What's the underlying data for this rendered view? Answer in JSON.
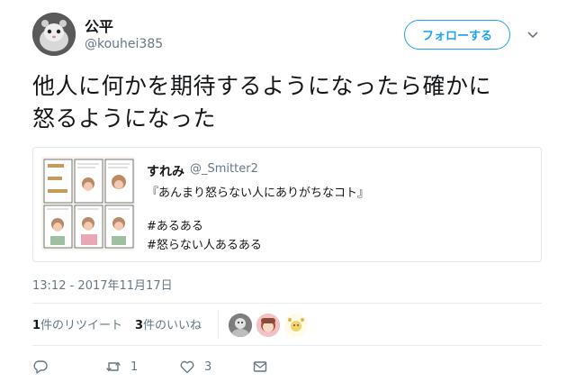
{
  "author": {
    "name": "公平",
    "handle": "@kouhei385",
    "follow_label": "フォローする"
  },
  "tweet": {
    "text_line1": "他人に何かを期待するようになったら確かに",
    "text_line2": "怒るようになった"
  },
  "quote": {
    "name": "すれみ",
    "handle": "@_Smitter2",
    "line1": "『あんまり怒らない人にありがちなコト』",
    "line2": "#あるある",
    "line3": "#怒らない人あるある"
  },
  "timestamp": "13:12 - 2017年11月17日",
  "stats": {
    "retweet_count": "1",
    "retweet_label": "件のリツイート",
    "like_count": "3",
    "like_label": "件のいいね"
  },
  "actions": {
    "reply_icon": "reply-icon",
    "retweet_icon": "retweet-icon",
    "retweet_count": "1",
    "like_icon": "heart-icon",
    "like_count": "3",
    "dm_icon": "envelope-icon"
  },
  "colors": {
    "accent": "#1da1f2",
    "text": "#14171a",
    "muted": "#657786",
    "border": "#e1e8ed"
  }
}
